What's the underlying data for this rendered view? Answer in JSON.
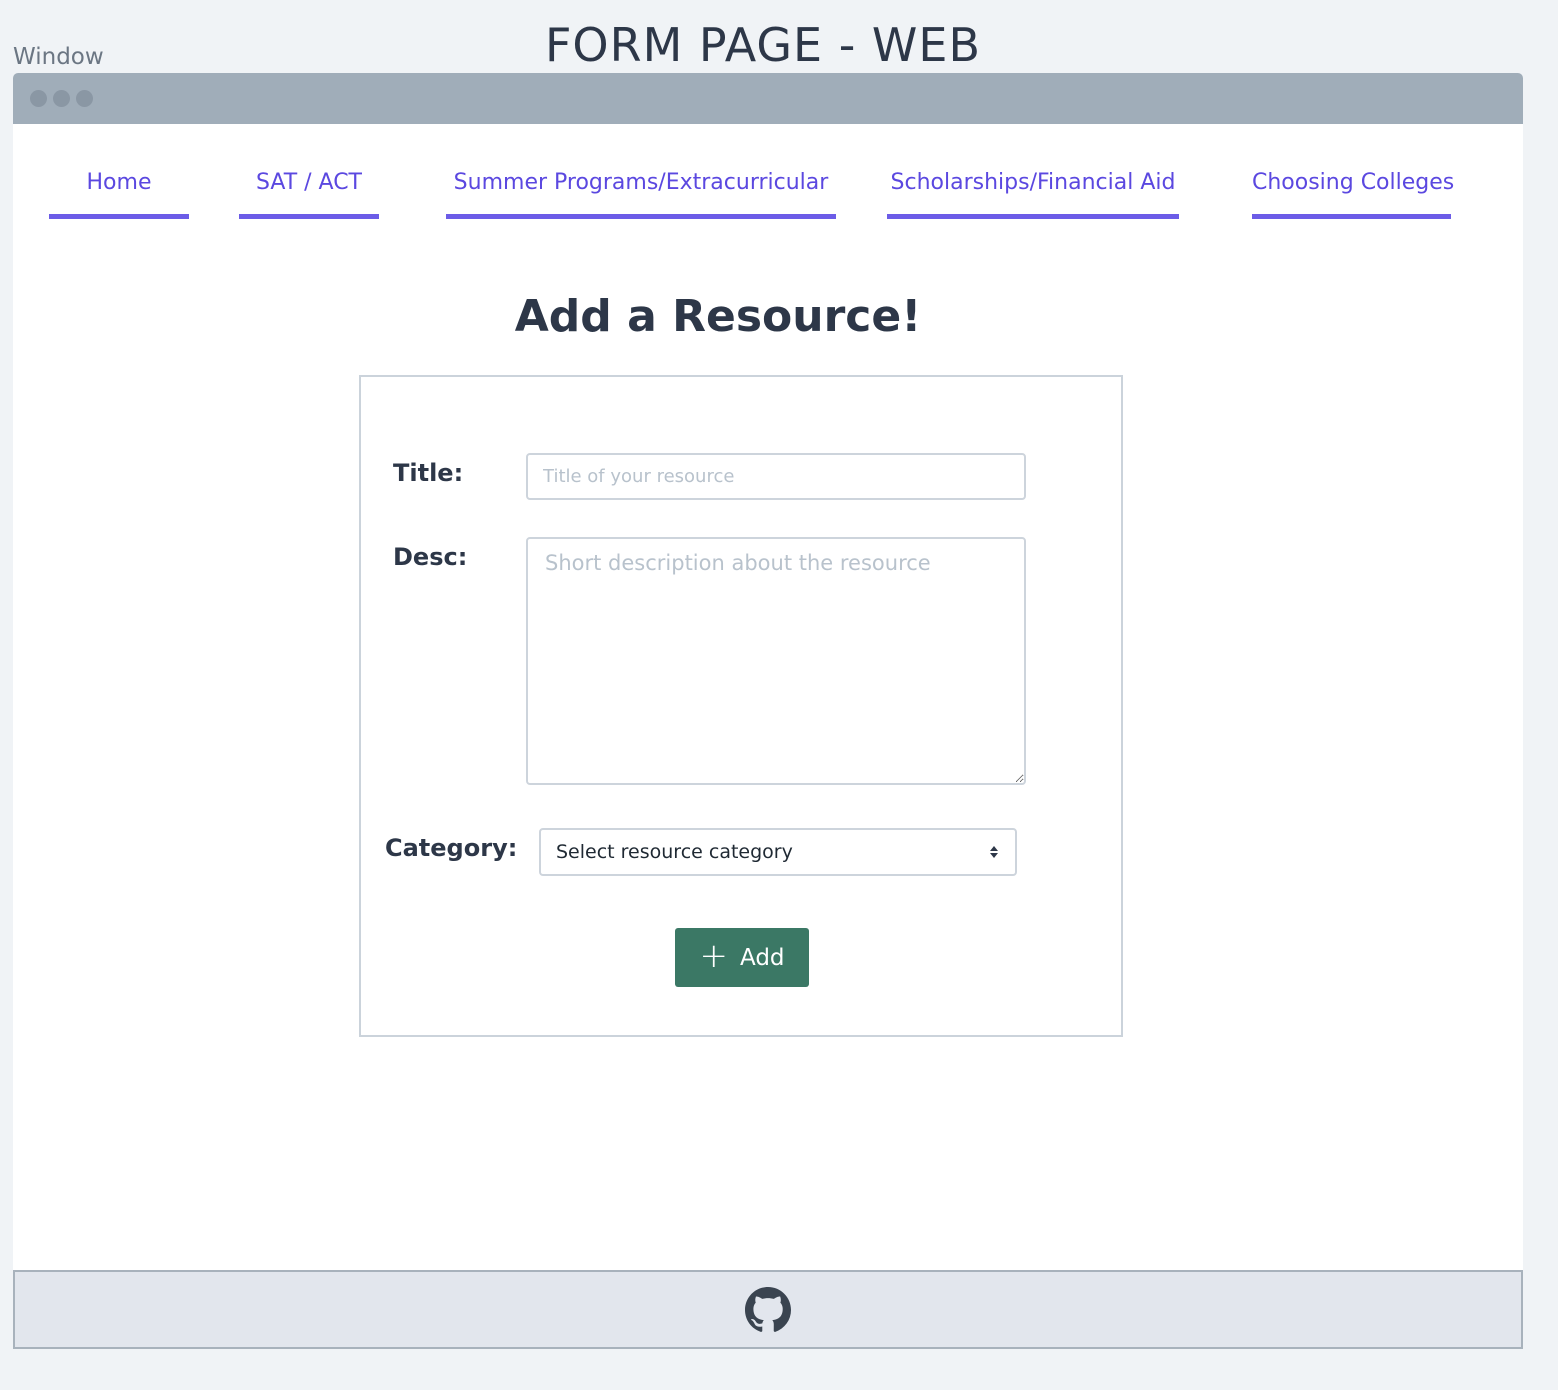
{
  "frame": {
    "label": "Window",
    "title": "FORM PAGE - WEB"
  },
  "nav": {
    "items": [
      {
        "label": "Home"
      },
      {
        "label": "SAT / ACT"
      },
      {
        "label": "Summer Programs/Extracurricular"
      },
      {
        "label": "Scholarships/Financial Aid"
      },
      {
        "label": "Choosing Colleges"
      }
    ]
  },
  "form": {
    "heading": "Add a Resource!",
    "title_label": "Title:",
    "title_placeholder": "Title of your resource",
    "title_value": "",
    "desc_label": "Desc:",
    "desc_placeholder": "Short description about the resource",
    "desc_value": "",
    "category_label": "Category:",
    "category_selected": "Select resource category",
    "add_button_label": "Add",
    "add_icon": "plus-icon"
  },
  "footer": {
    "icon": "github-icon"
  },
  "colors": {
    "accent": "#6c5ce7",
    "nav_text": "#5b48e0",
    "button": "#3b7865",
    "titlebar": "#a0adb9"
  }
}
